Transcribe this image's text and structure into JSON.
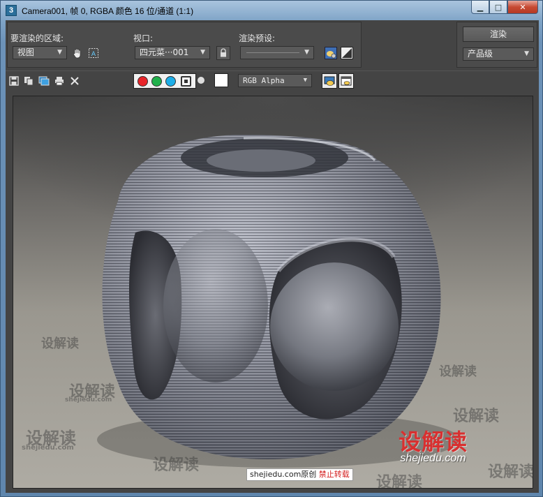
{
  "window": {
    "icon_text": "3",
    "title": "Camera001, 帧 0, RGBA 颜色 16 位/通道 (1:1)",
    "buttons": {
      "minimize": "▁",
      "maximize": "□",
      "close": "✕"
    }
  },
  "options": {
    "area_label": "要渲染的区域:",
    "area_value": "视图",
    "viewport_label": "视口:",
    "viewport_value": "四元菜···001",
    "preset_label": "渲染预设:",
    "preset_value": ""
  },
  "render": {
    "button": "渲染",
    "quality": "产品级"
  },
  "toolbar": {
    "channel_value": "RGB Alpha"
  },
  "colors": {
    "red_channel": "#e8252a",
    "green_channel": "#22b14c",
    "blue_channel": "#1eaee8",
    "watermark_red": "#d83030"
  },
  "watermark": {
    "logo_cn": "设解读",
    "logo_en": "shejiedu.com",
    "tile_cn": "设解读",
    "tile_en": "shejiedu.com",
    "credit_site": "shejiedu.com原创",
    "credit_warning": "禁止转载"
  }
}
